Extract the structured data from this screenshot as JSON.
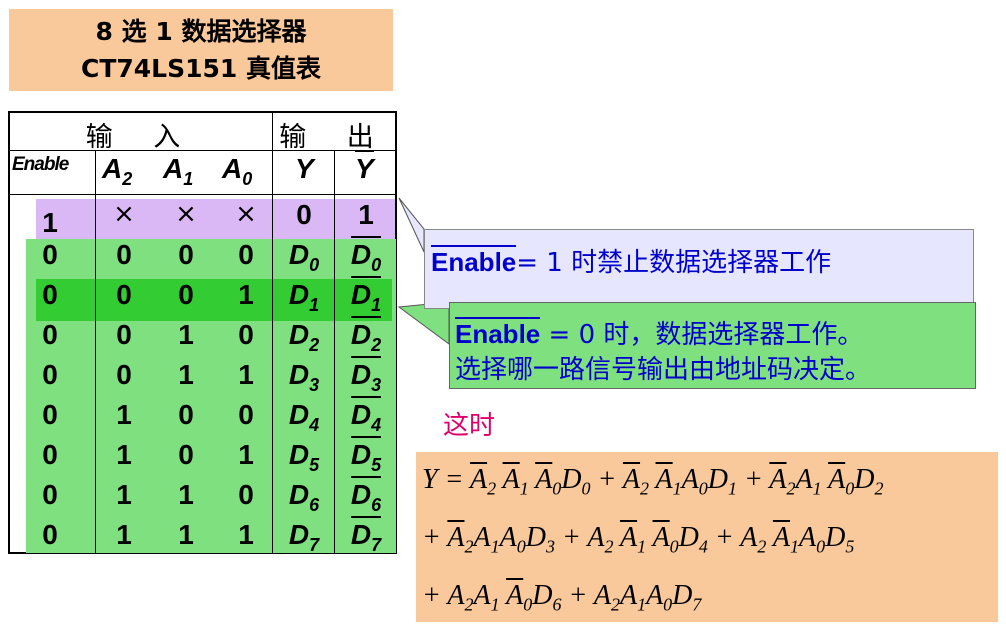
{
  "title": {
    "line1": "8 选 1 数据选择器",
    "line2": "CT74LS151 真值表"
  },
  "table": {
    "group_in": "输 入",
    "group_out": "输 出",
    "col_enable": "Enable",
    "rows": [
      [
        "1",
        "×",
        "×",
        "×",
        "0",
        "1"
      ],
      [
        "0",
        "0",
        "0",
        "0",
        "D0",
        "D0"
      ],
      [
        "0",
        "0",
        "0",
        "1",
        "D1",
        "D1"
      ],
      [
        "0",
        "0",
        "1",
        "0",
        "D2",
        "D2"
      ],
      [
        "0",
        "0",
        "1",
        "1",
        "D3",
        "D3"
      ],
      [
        "0",
        "1",
        "0",
        "0",
        "D4",
        "D4"
      ],
      [
        "0",
        "1",
        "0",
        "1",
        "D5",
        "D5"
      ],
      [
        "0",
        "1",
        "1",
        "0",
        "D6",
        "D6"
      ],
      [
        "0",
        "1",
        "1",
        "1",
        "D7",
        "D7"
      ]
    ]
  },
  "callout1": {
    "prefix": "Enable",
    "text": "= 1 时禁止数据选择器工作"
  },
  "callout2": {
    "prefix": "Enable",
    "text1": " = 0 时，数据选择器工作。",
    "text2": "选择哪一路信号输出由地址码决定。"
  },
  "zheshi": "这时",
  "colors": {
    "title_bg": "#f9c89b",
    "row_purple": "#d9b8f5",
    "row_green": "#7fe07f",
    "row_highlight": "#33cc33",
    "callout_blue": "#0000cc",
    "zheshi": "#e0006a"
  }
}
